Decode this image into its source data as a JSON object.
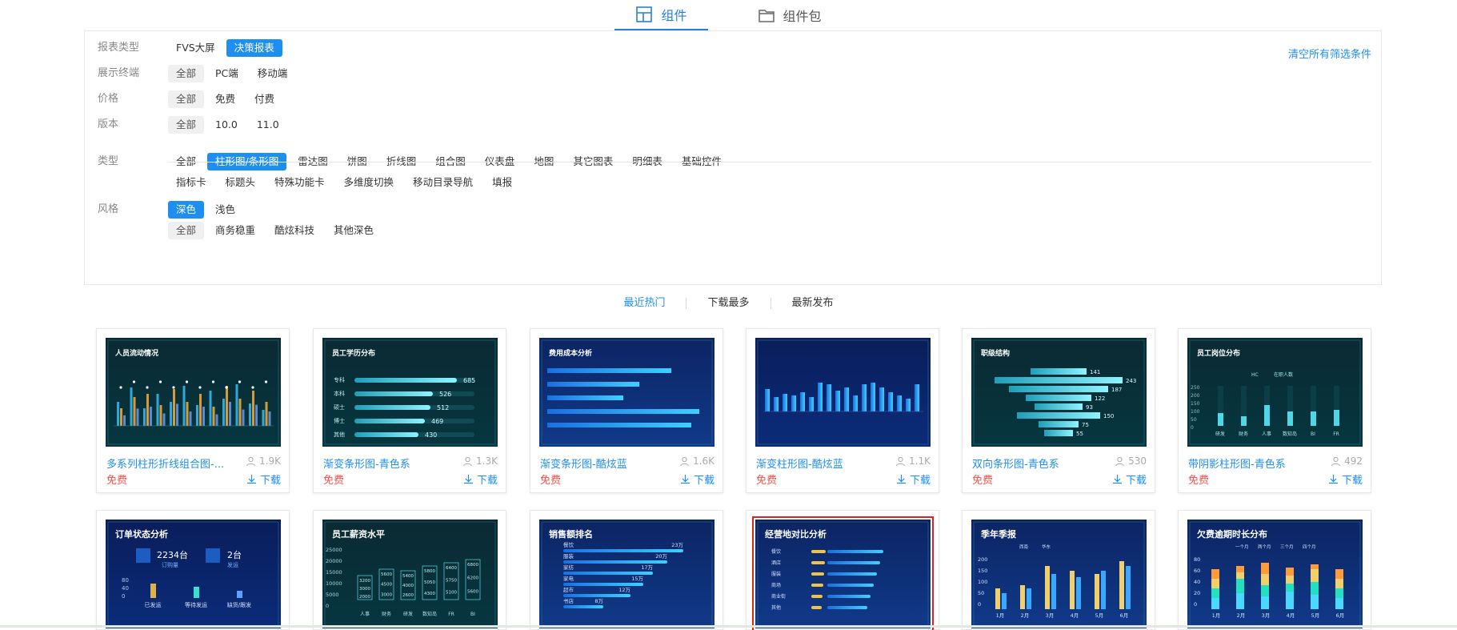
{
  "tabs": [
    {
      "label": "组件",
      "active": true,
      "icon": "layout-icon"
    },
    {
      "label": "组件包",
      "active": false,
      "icon": "folder-icon"
    }
  ],
  "filters": {
    "clear_all": "清空所有筛选条件",
    "rows": [
      {
        "label": "报表类型",
        "options": [
          {
            "text": "FVS大屏",
            "state": "none"
          },
          {
            "text": "决策报表",
            "state": "blue"
          }
        ]
      },
      {
        "label": "展示终端",
        "options": [
          {
            "text": "全部",
            "state": "gray"
          },
          {
            "text": "PC端",
            "state": "none"
          },
          {
            "text": "移动端",
            "state": "none"
          }
        ]
      },
      {
        "label": "价格",
        "options": [
          {
            "text": "全部",
            "state": "gray"
          },
          {
            "text": "免费",
            "state": "none"
          },
          {
            "text": "付费",
            "state": "none"
          }
        ]
      },
      {
        "label": "版本",
        "options": [
          {
            "text": "全部",
            "state": "gray"
          },
          {
            "text": "10.0",
            "state": "none"
          },
          {
            "text": "11.0",
            "state": "none"
          }
        ]
      },
      {
        "label": "类型",
        "options": [
          {
            "text": "全部",
            "state": "none"
          },
          {
            "text": "柱形图/条形图",
            "state": "blue"
          },
          {
            "text": "雷达图",
            "state": "none"
          },
          {
            "text": "饼图",
            "state": "none"
          },
          {
            "text": "折线图",
            "state": "none"
          },
          {
            "text": "组合图",
            "state": "none"
          },
          {
            "text": "仪表盘",
            "state": "none"
          },
          {
            "text": "地图",
            "state": "none"
          },
          {
            "text": "其它图表",
            "state": "none"
          },
          {
            "text": "明细表",
            "state": "none"
          },
          {
            "text": "基础控件",
            "state": "none"
          }
        ]
      },
      {
        "label": "",
        "options": [
          {
            "text": "指标卡",
            "state": "none"
          },
          {
            "text": "标题头",
            "state": "none"
          },
          {
            "text": "特殊功能卡",
            "state": "none"
          },
          {
            "text": "多维度切换",
            "state": "none"
          },
          {
            "text": "移动目录导航",
            "state": "none"
          },
          {
            "text": "填报",
            "state": "none"
          }
        ]
      },
      {
        "label": "风格",
        "options": [
          {
            "text": "深色",
            "state": "blue"
          },
          {
            "text": "浅色",
            "state": "none"
          }
        ]
      },
      {
        "label": "",
        "options": [
          {
            "text": "全部",
            "state": "gray"
          },
          {
            "text": "商务稳重",
            "state": "none"
          },
          {
            "text": "酷炫科技",
            "state": "none"
          },
          {
            "text": "其他深色",
            "state": "none"
          }
        ]
      }
    ]
  },
  "sort": [
    {
      "label": "最近热门",
      "active": true
    },
    {
      "label": "下载最多",
      "active": false
    },
    {
      "label": "最新发布",
      "active": false
    }
  ],
  "colors": {
    "accent": "#1d8ff0",
    "price": "#f5534a",
    "selected_outline": "#e02020"
  },
  "cards": [
    {
      "title": "多系列柱形折线组合图-...",
      "views": "1.9K",
      "price": "免费",
      "download": "下载",
      "thumb_title": "人员流动情况",
      "style": "teal"
    },
    {
      "title": "渐变条形图-青色系",
      "views": "1.3K",
      "price": "免费",
      "download": "下载",
      "thumb_title": "员工学历分布",
      "style": "teal",
      "bars": [
        {
          "label": "专科",
          "value": "685"
        },
        {
          "label": "本科",
          "value": "526"
        },
        {
          "label": "硕士",
          "value": "512"
        },
        {
          "label": "博士",
          "value": "469"
        },
        {
          "label": "其他",
          "value": "430"
        }
      ]
    },
    {
      "title": "渐变条形图-酷炫蓝",
      "views": "1.6K",
      "price": "免费",
      "download": "下载",
      "thumb_title": "费用成本分析",
      "style": "blue"
    },
    {
      "title": "渐变柱形图-酷炫蓝",
      "views": "1.1K",
      "price": "免费",
      "download": "下载",
      "thumb_title": "",
      "style": "navy"
    },
    {
      "title": "双向条形图-青色系",
      "views": "530",
      "price": "免费",
      "download": "下载",
      "thumb_title": "职级结构",
      "style": "teal",
      "bars": [
        {
          "value": "141"
        },
        {
          "value": "243"
        },
        {
          "value": "187"
        },
        {
          "value": "122"
        },
        {
          "value": "93"
        },
        {
          "value": "150"
        },
        {
          "value": "75"
        },
        {
          "value": "55"
        }
      ]
    },
    {
      "title": "带阴影柱形图-青色系",
      "views": "492",
      "price": "免费",
      "download": "下载",
      "thumb_title": "员工岗位分布",
      "style": "teal",
      "legend": [
        "HC",
        "在职人数"
      ],
      "categories": [
        "研发",
        "财务",
        "人事",
        "数知岛",
        "BI",
        "FR"
      ],
      "yticks": [
        "250",
        "200",
        "150",
        "100",
        "50",
        "0"
      ]
    },
    {
      "thumb_title": "订单状态分析",
      "style": "navy",
      "stats": [
        {
          "value": "2234",
          "unit": "台",
          "label": "订购量"
        },
        {
          "value": "2",
          "unit": "台",
          "label": "发运"
        }
      ],
      "categories": [
        "已发运",
        "等待发运",
        "缺货/跟发"
      ],
      "yticks": [
        "80",
        "40",
        "0"
      ]
    },
    {
      "thumb_title": "员工薪资水平",
      "style": "teal",
      "yticks": [
        "25000",
        "20000",
        "15000",
        "10000",
        "5000",
        "0"
      ],
      "categories": [
        "人事",
        "财务",
        "研发",
        "数知岛",
        "FR",
        "BI"
      ],
      "boxes": [
        [
          "3200",
          "3000",
          "2000"
        ],
        [
          "5600",
          "4500",
          "3000"
        ],
        [
          "5400",
          "4000",
          "2600"
        ],
        [
          "5800",
          "5050",
          "4300"
        ],
        [
          "6400",
          "5750",
          "5100"
        ],
        [
          "6800",
          "6200",
          "5600"
        ]
      ]
    },
    {
      "thumb_title": "销售额排名",
      "style": "blue",
      "bars": [
        {
          "label": "餐饮",
          "value": "23万"
        },
        {
          "label": "服装",
          "value": "20万"
        },
        {
          "label": "家纺",
          "value": "17万"
        },
        {
          "label": "家电",
          "value": "15万"
        },
        {
          "label": "超市",
          "value": "12万"
        },
        {
          "label": "书店",
          "value": "8万"
        }
      ]
    },
    {
      "thumb_title": "经营地对比分析",
      "style": "blue",
      "selected": true,
      "rows": [
        "餐饮",
        "酒店",
        "服装",
        "商场",
        "商业街",
        "其他"
      ]
    },
    {
      "thumb_title": "季年季报",
      "style": "blue",
      "categories": [
        "1月",
        "2月",
        "3月",
        "4月",
        "5月",
        "6月"
      ],
      "yticks": [
        "200",
        "150",
        "100",
        "50",
        "0"
      ],
      "legend": [
        "西南",
        "华东"
      ]
    },
    {
      "thumb_title": "欠费逾期时长分布",
      "style": "blue",
      "categories": [
        "1月",
        "2月",
        "3月",
        "4月",
        "5月",
        "6月"
      ],
      "yticks": [
        "80",
        "60",
        "40",
        "20",
        "0"
      ],
      "legend": [
        "一个月",
        "两个月",
        "三个月",
        "四个月"
      ]
    }
  ]
}
